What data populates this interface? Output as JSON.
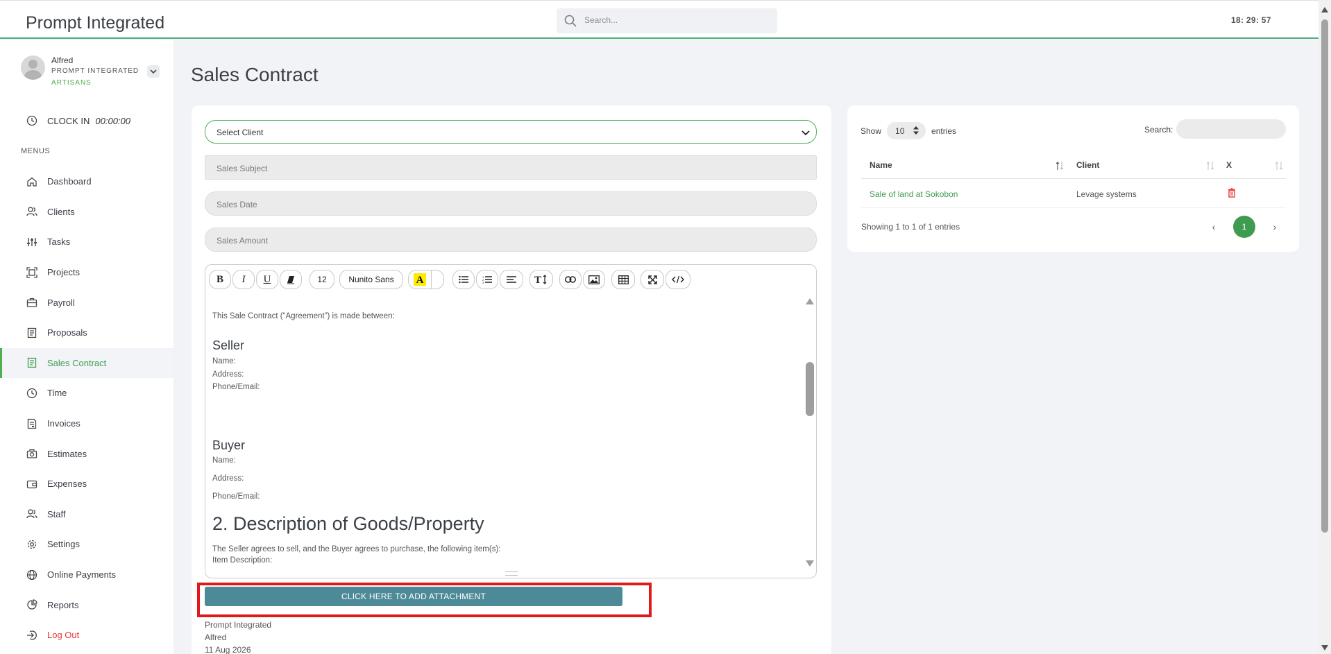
{
  "app": {
    "brand": "Prompt Integrated",
    "search_placeholder": "Search...",
    "clock": "18: 29: 57"
  },
  "colors": {
    "accent": "#4caf50",
    "attach_button": "#4d8a97",
    "highlight": "#e0191c",
    "logout": "#e53935"
  },
  "user": {
    "name": "Alfred",
    "org_line1": "PROMPT INTEGRATED",
    "org_line2": "ARTISANS"
  },
  "clockin": {
    "label": "CLOCK IN",
    "time": "00:00:00"
  },
  "menus_title": "MENUS",
  "menu": [
    {
      "label": "Dashboard",
      "icon": "home-icon"
    },
    {
      "label": "Clients",
      "icon": "users-icon"
    },
    {
      "label": "Tasks",
      "icon": "sliders-icon"
    },
    {
      "label": "Projects",
      "icon": "projects-icon"
    },
    {
      "label": "Payroll",
      "icon": "briefcase-icon"
    },
    {
      "label": "Proposals",
      "icon": "document-icon"
    },
    {
      "label": "Sales Contract",
      "icon": "contract-icon",
      "active": true
    },
    {
      "label": "Time",
      "icon": "clock-icon"
    },
    {
      "label": "Invoices",
      "icon": "invoice-icon"
    },
    {
      "label": "Estimates",
      "icon": "estimate-icon"
    },
    {
      "label": "Expenses",
      "icon": "wallet-icon"
    },
    {
      "label": "Staff",
      "icon": "users-icon"
    },
    {
      "label": "Settings",
      "icon": "gear-icon"
    },
    {
      "label": "Online Payments",
      "icon": "globe-icon"
    },
    {
      "label": "Reports",
      "icon": "pie-chart-icon"
    },
    {
      "label": "Log Out",
      "icon": "logout-icon"
    }
  ],
  "page_title": "Sales Contract",
  "form": {
    "select_client": "Select Client",
    "subject_placeholder": "Sales Subject",
    "date_placeholder": "Sales Date",
    "amount_placeholder": "Sales Amount"
  },
  "editor": {
    "font_size": "12",
    "font_family": "Nunito Sans",
    "intro": "This Sale Contract (“Agreement”) is made between:",
    "seller_heading": "Seller",
    "seller_name": "Name:",
    "seller_address": "Address:",
    "seller_phone": "Phone/Email:",
    "buyer_heading": "Buyer",
    "buyer_name": "Name:",
    "buyer_address": "Address:",
    "buyer_phone": "Phone/Email:",
    "section2_heading": "2. Description of Goods/Property",
    "section2_text": "The Seller agrees to sell, and the Buyer agrees to purchase, the following item(s):",
    "section2_next": "Item Description:"
  },
  "attachment_button": "CLICK HERE TO ADD ATTACHMENT",
  "footer": {
    "company": "Prompt Integrated",
    "user": "Alfred",
    "date": "11 Aug 2026"
  },
  "table": {
    "show_label": "Show",
    "entries_value": "10",
    "entries_label": "entries",
    "search_label": "Search:",
    "columns": [
      "Name",
      "Client",
      "X"
    ],
    "rows": [
      {
        "name": "Sale of land at Sokobon",
        "client": "Levage systems"
      }
    ],
    "info": "Showing 1 to 1 of 1 entries",
    "current_page": "1",
    "prev": "‹",
    "next": "›"
  }
}
